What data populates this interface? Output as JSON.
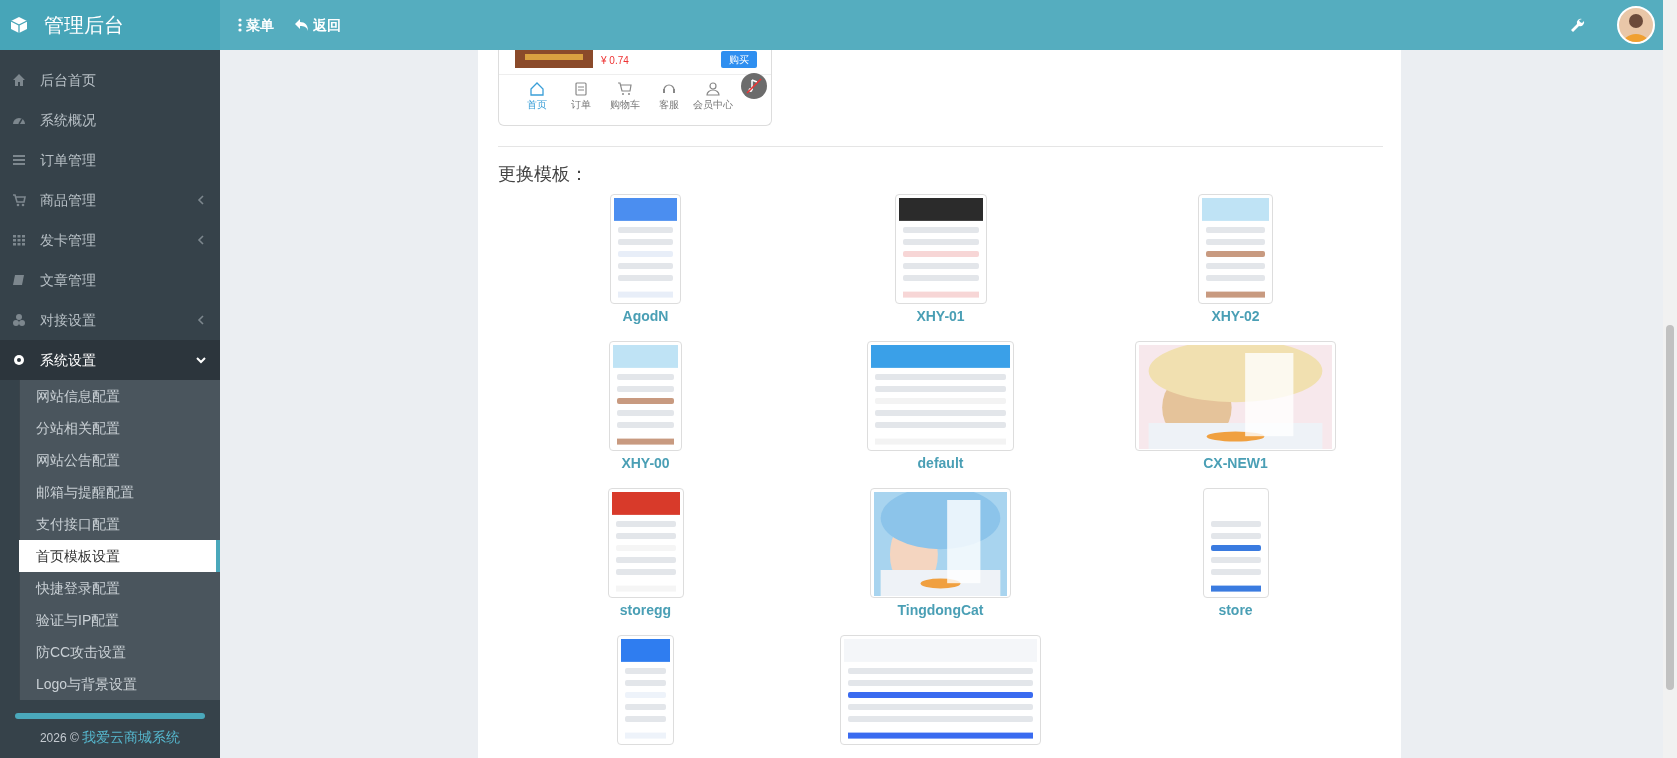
{
  "brand": {
    "title": "管理后台"
  },
  "topbar": {
    "buttons": [
      {
        "label": "菜单",
        "kind": "menu"
      },
      {
        "label": "返回",
        "kind": "back"
      }
    ]
  },
  "sidebar": {
    "items": [
      {
        "label": "后台首页",
        "kind": "link"
      },
      {
        "label": "系统概况",
        "kind": "link"
      },
      {
        "label": "订单管理",
        "kind": "link"
      },
      {
        "label": "商品管理",
        "kind": "group",
        "expanded": false
      },
      {
        "label": "发卡管理",
        "kind": "group",
        "expanded": false
      },
      {
        "label": "文章管理",
        "kind": "link"
      },
      {
        "label": "对接设置",
        "kind": "group",
        "expanded": false
      },
      {
        "label": "系统设置",
        "kind": "group",
        "expanded": true,
        "children": [
          {
            "label": "网站信息配置",
            "selected": false
          },
          {
            "label": "分站相关配置",
            "selected": false
          },
          {
            "label": "网站公告配置",
            "selected": false
          },
          {
            "label": "邮箱与提醒配置",
            "selected": false
          },
          {
            "label": "支付接口配置",
            "selected": false
          },
          {
            "label": "首页模板设置",
            "selected": true
          },
          {
            "label": "快捷登录配置",
            "selected": false
          },
          {
            "label": "验证与IP配置",
            "selected": false
          },
          {
            "label": "防CC攻击设置",
            "selected": false
          },
          {
            "label": "Logo与背景设置",
            "selected": false
          }
        ]
      }
    ]
  },
  "sidebar_footer": {
    "year": "2026 ©",
    "link": "我爱云商城系统"
  },
  "preview": {
    "price": "¥ 0.74",
    "buy": "购买",
    "tabs": [
      {
        "label": "首页",
        "selected": true
      },
      {
        "label": "订单",
        "selected": false
      },
      {
        "label": "购物车",
        "selected": false
      },
      {
        "label": "客服",
        "selected": false
      },
      {
        "label": "会员中心",
        "selected": false
      }
    ]
  },
  "templates_heading": "更换模板：",
  "templates": [
    {
      "kind": "named",
      "name": "AgodN"
    },
    {
      "kind": "named",
      "name": "XHY-01"
    },
    {
      "kind": "named",
      "name": "XHY-02"
    },
    {
      "kind": "named",
      "name": "XHY-00"
    },
    {
      "kind": "named",
      "name": "default"
    },
    {
      "kind": "named",
      "name": "CX-NEW1"
    },
    {
      "kind": "named",
      "name": "storegg"
    },
    {
      "kind": "named",
      "name": "TingdongCat"
    },
    {
      "kind": "named",
      "name": "store"
    },
    {
      "kind": "picture"
    },
    {
      "kind": "picture"
    }
  ]
}
